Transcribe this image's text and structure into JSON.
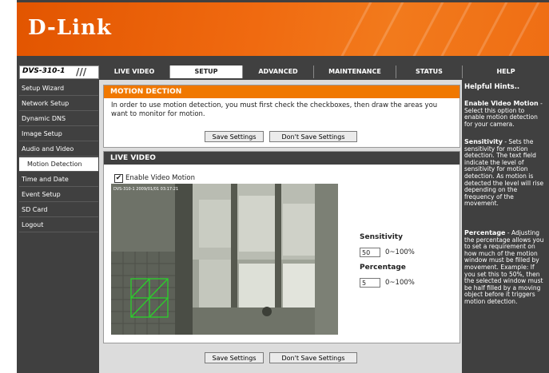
{
  "header": {
    "logo": "D-Link",
    "model": "DVS-310-1",
    "model_slash": "///"
  },
  "tabs": [
    {
      "label": "LIVE VIDEO"
    },
    {
      "label": "SETUP"
    },
    {
      "label": "ADVANCED"
    },
    {
      "label": "MAINTENANCE"
    },
    {
      "label": "STATUS"
    },
    {
      "label": "HELP"
    }
  ],
  "sidebar": {
    "items": [
      {
        "label": "Setup Wizard"
      },
      {
        "label": "Network Setup"
      },
      {
        "label": "Dynamic DNS"
      },
      {
        "label": "Image Setup"
      },
      {
        "label": "Audio and Video"
      },
      {
        "label": "Motion Detection"
      },
      {
        "label": "Time and Date"
      },
      {
        "label": "Event Setup"
      },
      {
        "label": "SD Card"
      },
      {
        "label": "Logout"
      }
    ]
  },
  "motion_detection": {
    "title": "MOTION DECTION",
    "description": "In order to use motion detection, you must first check the checkboxes, then draw the areas you want to monitor for motion.",
    "save_label": "Save Settings",
    "dont_save_label": "Don't Save Settings"
  },
  "live_video": {
    "title": "LIVE VIDEO",
    "enable_label": "Enable Video Motion",
    "enable_checked": true,
    "check_glyph": "✔",
    "video_overlay_text": "DVS-310-1 2009/01/01 03:17:21",
    "sensitivity_label": "Sensitivity",
    "sensitivity_value": "50",
    "sensitivity_range": "0~100%",
    "percentage_label": "Percentage",
    "percentage_value": "5",
    "percentage_range": "0~100%",
    "save_label": "Save Settings",
    "dont_save_label": "Don't Save Settings"
  },
  "help": {
    "title": "Helpful Hints..",
    "blocks": [
      {
        "heading": "Enable Video Motion",
        "text": " - Select this option to enable motion detection for your camera."
      },
      {
        "heading": "Sensitivity",
        "text": " - Sets the sensitivity for motion detection. The text field indicate the level of sensitivity for motion detection. As motion is detected the level will rise depending on the frequency of the movement."
      },
      {
        "heading": "Percentage",
        "text": " - Adjusting the percentage allows you to set a requirement on how much of the motion window must be filled by movement. Example: If you set this to 50%, then the selected window must be half filled by a moving object before it triggers motion detection."
      }
    ]
  },
  "colors": {
    "brand_orange": "#f07800",
    "dark_gray": "#404040",
    "detection_grid": "#2ad02a"
  }
}
